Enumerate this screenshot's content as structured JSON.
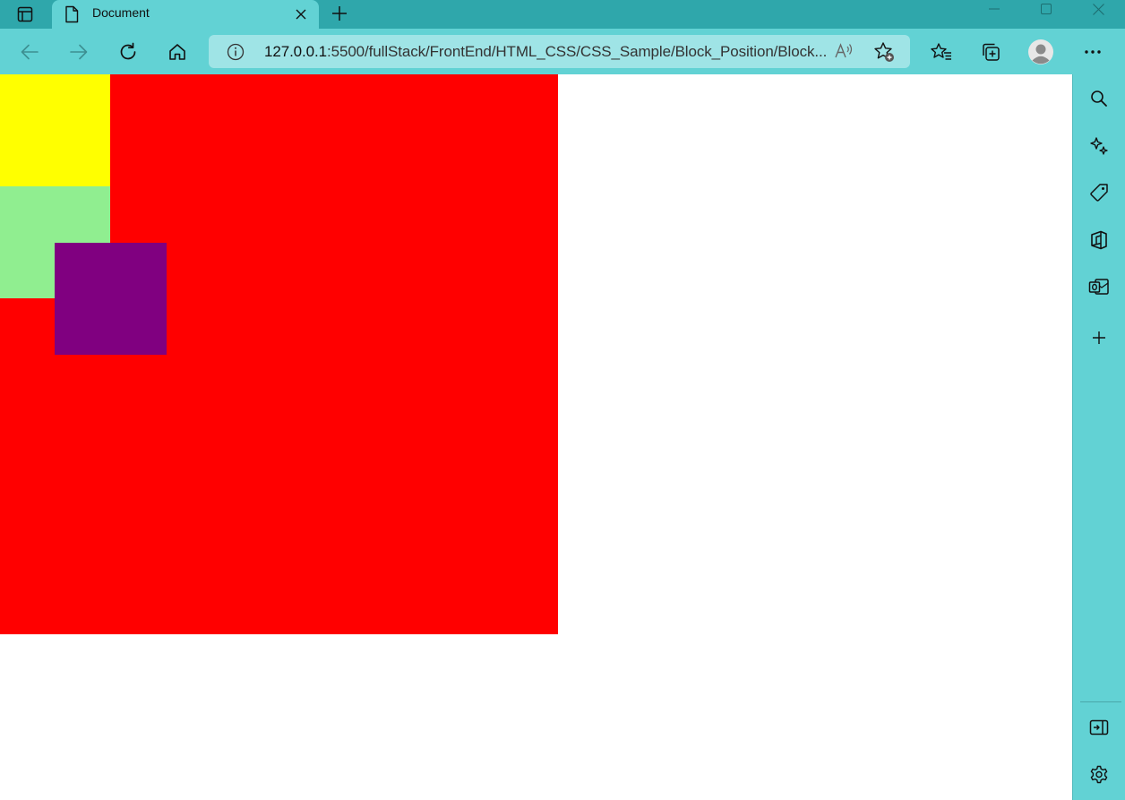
{
  "browser": {
    "tab": {
      "title": "Document"
    },
    "address": {
      "host": "127.0.0.1",
      "path": ":5500/fullStack/FrontEnd/HTML_CSS/CSS_Sample/Block_Position/Block..."
    },
    "icons": {
      "tab_actions": "tab-actions-icon",
      "page": "document-icon",
      "close": "close-icon",
      "new_tab": "plus-icon",
      "back": "back-arrow-icon",
      "forward": "forward-arrow-icon",
      "refresh": "refresh-icon",
      "home": "home-icon",
      "info": "info-icon",
      "read_aloud": "read-aloud-icon",
      "add_favorite": "add-favorite-icon",
      "favorites": "favorites-icon",
      "collections": "collections-icon",
      "profile": "profile-icon",
      "more": "more-icon"
    },
    "sidebar_icons": [
      "search-icon",
      "copilot-icon",
      "shopping-tag-icon",
      "office-icon",
      "outlook-icon",
      "add-icon",
      "hide-sidebar-icon",
      "settings-icon"
    ]
  },
  "colors": {
    "titlebar": "#2fa7ab",
    "toolbar": "#62d2d4",
    "addressbar": "#9fe4e6",
    "red_box": "#ff0000",
    "yellow_box": "#ffff00",
    "green_box": "#90ee90",
    "purple_box": "#800080"
  }
}
